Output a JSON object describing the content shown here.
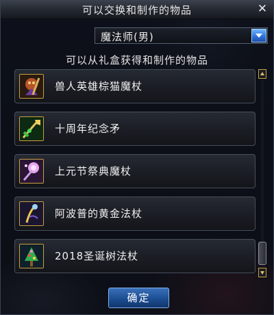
{
  "window": {
    "title": "可以交换和制作的物品",
    "close_glyph": "✕"
  },
  "class_select": {
    "selected": "魔法师(男)",
    "arrow_icon": "chevron-down-icon",
    "accent_color": "#2d6fd6"
  },
  "list": {
    "heading": "可以从礼盒获得和制作的物品",
    "items": [
      {
        "label": "兽人英雄棕猫魔杖",
        "icon": "orc-hero-staff-icon"
      },
      {
        "label": "十周年纪念矛",
        "icon": "anniversary-spear-icon"
      },
      {
        "label": "上元节祭典魔杖",
        "icon": "lantern-festival-staff-icon"
      },
      {
        "label": "阿波普的黄金法杖",
        "icon": "apophis-golden-staff-icon"
      },
      {
        "label": "2018圣诞树法杖",
        "icon": "christmas-tree-staff-icon"
      }
    ]
  },
  "footer": {
    "confirm_label": "确定"
  },
  "colors": {
    "icon_border": "#c9a040",
    "button_blue": "#1c4e93"
  }
}
